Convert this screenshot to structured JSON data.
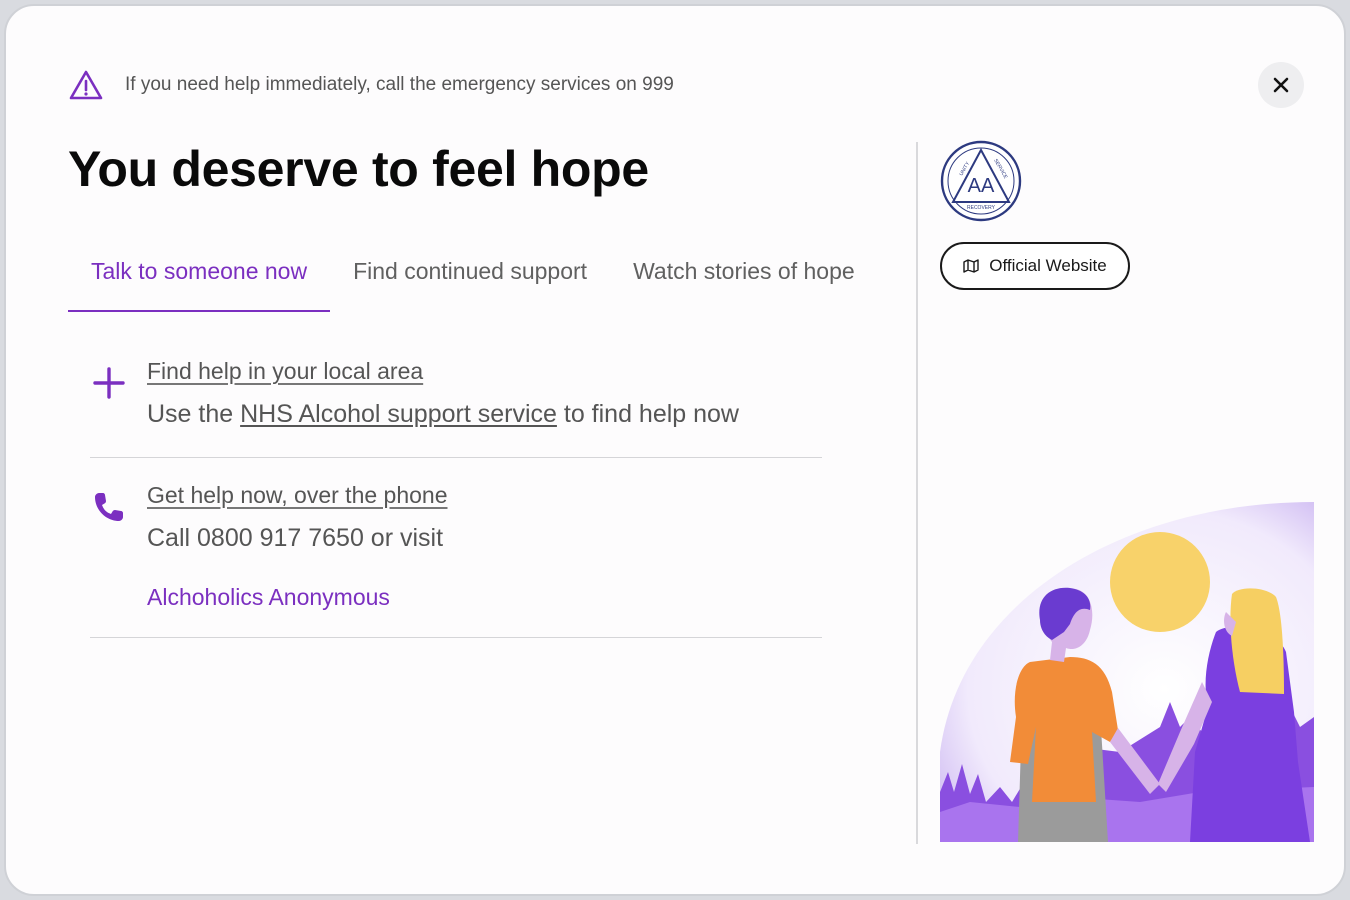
{
  "banner": {
    "text": "If you need help immediately, call the emergency services on 999",
    "icon": "warning-triangle-icon"
  },
  "close": {
    "icon": "close-icon"
  },
  "title": "You deserve to feel hope",
  "tabs": [
    {
      "label": "Talk to someone now",
      "active": true
    },
    {
      "label": "Find continued support",
      "active": false
    },
    {
      "label": "Watch stories of hope",
      "active": false
    }
  ],
  "items": {
    "local": {
      "icon": "plus-icon",
      "heading": "Find help in your local area",
      "desc_prefix": "Use the ",
      "desc_link": "NHS Alcohol support service",
      "desc_suffix": " to find help now"
    },
    "phone": {
      "icon": "phone-icon",
      "heading": "Get help now, over the phone",
      "desc": "Call 0800 917 7650 or visit",
      "link": "Alchoholics Anonymous"
    }
  },
  "sidebar": {
    "logo_text": "AA",
    "logo_ring": [
      "UNITY",
      "SERVICE",
      "RECOVERY"
    ],
    "official_button": "Official Website",
    "official_icon": "map-icon"
  },
  "colors": {
    "accent": "#7b2fc0",
    "sun": "#f8d26a",
    "shirt": "#f28c38",
    "grass": "#8a4fe0"
  }
}
